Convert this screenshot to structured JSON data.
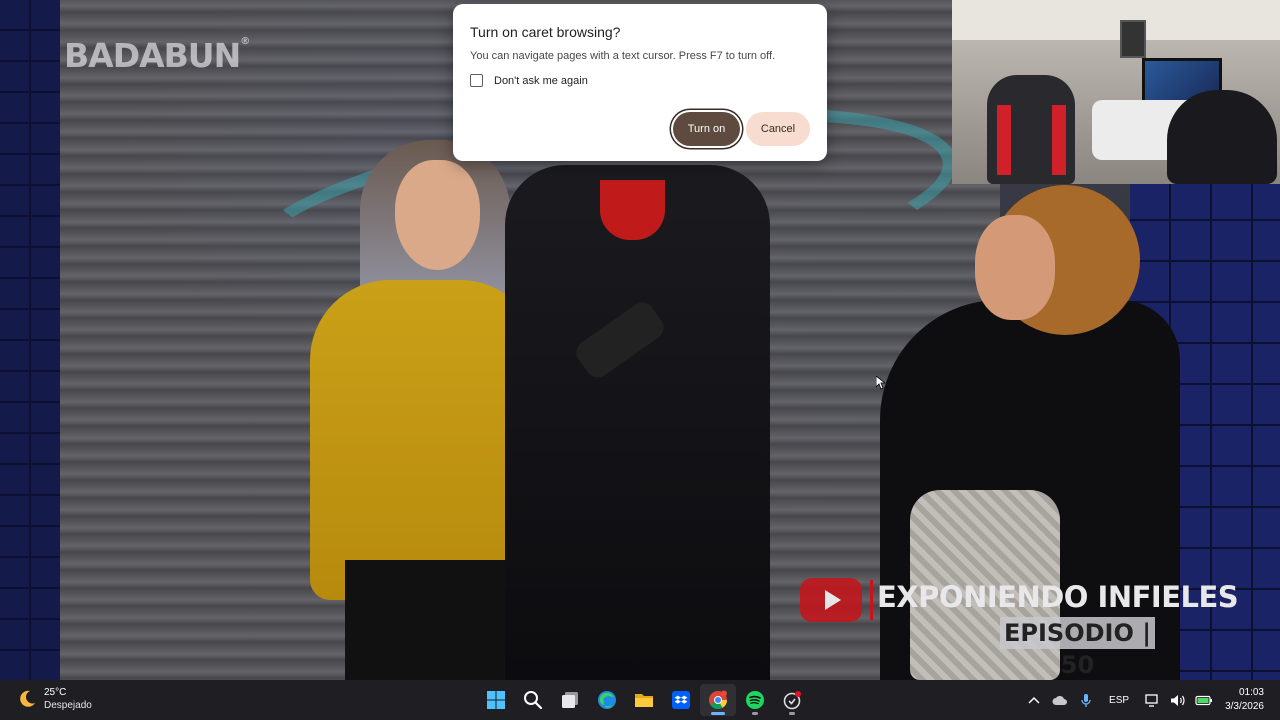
{
  "video": {
    "watermark": "BADABUN",
    "watermark_mark": "®",
    "overlay_title": "EXPONIENDO INFIELES",
    "overlay_episode": "EPISODIO | 50"
  },
  "dialog": {
    "title": "Turn on caret browsing?",
    "body": "You can navigate pages with a text cursor. Press F7 to turn off.",
    "checkbox_label": "Don't ask me again",
    "checkbox_checked": false,
    "primary_button": "Turn on",
    "secondary_button": "Cancel"
  },
  "taskbar": {
    "weather": {
      "icon": "moon-icon",
      "temperature": "25°C",
      "description": "Despejado"
    },
    "apps": [
      {
        "name": "start",
        "icon": "windows-icon"
      },
      {
        "name": "search",
        "icon": "search-icon"
      },
      {
        "name": "task-view",
        "icon": "task-view-icon"
      },
      {
        "name": "edge",
        "icon": "edge-icon"
      },
      {
        "name": "file-explorer",
        "icon": "folder-icon"
      },
      {
        "name": "dropbox",
        "icon": "dropbox-icon"
      },
      {
        "name": "chrome",
        "icon": "chrome-icon",
        "running": true,
        "active": true
      },
      {
        "name": "spotify",
        "icon": "spotify-icon",
        "running": true
      },
      {
        "name": "app-notification",
        "icon": "app-icon",
        "running": true
      }
    ],
    "tray": {
      "language": "ESP",
      "time": "01:03",
      "date": "3/3/2026"
    }
  },
  "colors": {
    "dialog_primary": "#5e4a3e",
    "dialog_secondary": "#f7dccf",
    "taskbar_bg": "#1f1f23",
    "active_indicator": "#6cb4ff"
  }
}
